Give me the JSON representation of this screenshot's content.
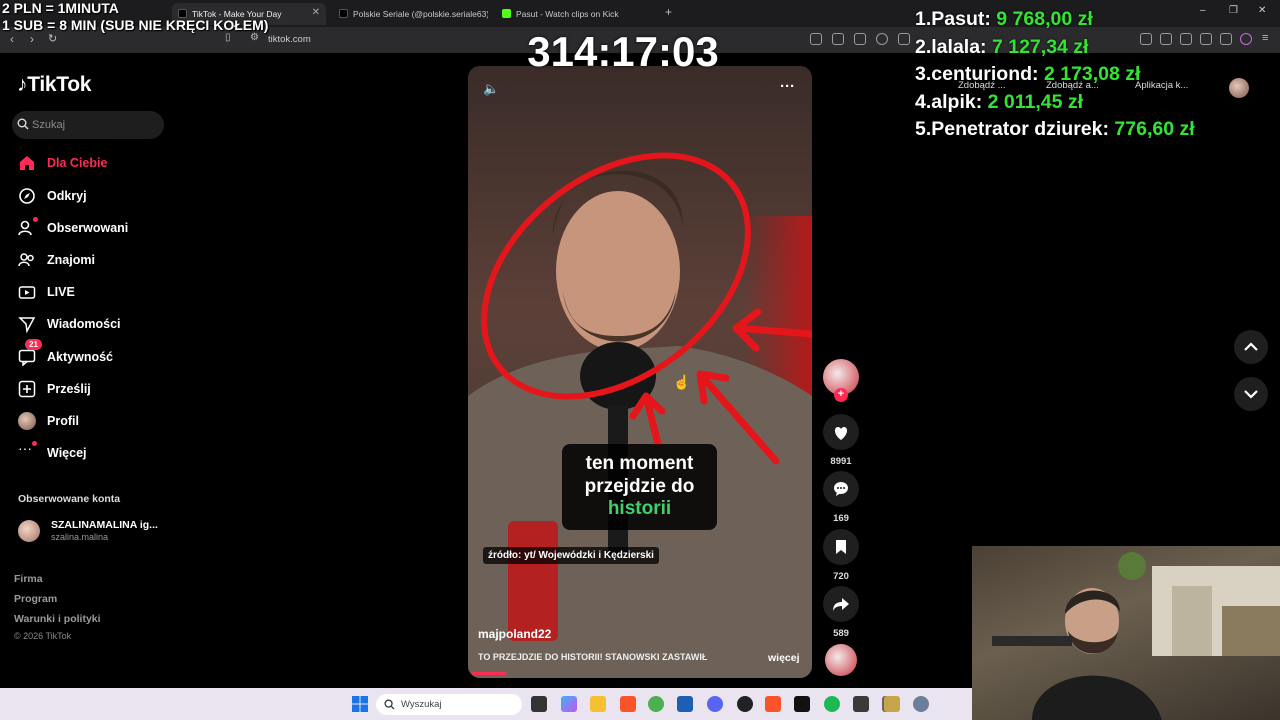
{
  "overlay": {
    "line1": "2 PLN = 1MINUTA",
    "line2": "1 SUB = 8 MIN (SUB NIE KRĘCI KOŁEM)",
    "timer": "314:17:03"
  },
  "leaderboard": [
    {
      "rank": "1.",
      "name": "Pasut:",
      "amount": "9 768,00 zł"
    },
    {
      "rank": "2.",
      "name": "lalala:",
      "amount": "7 127,34 zł"
    },
    {
      "rank": "3.",
      "name": "centuriond:",
      "amount": "2 173,08 zł"
    },
    {
      "rank": "4.",
      "name": "alpik:",
      "amount": "2 011,45 zł"
    },
    {
      "rank": "5.",
      "name": "Penetrator dziurek:",
      "amount": "776,60 zł"
    }
  ],
  "browser": {
    "tabs": [
      {
        "label": "TikTok - Make Your Day",
        "icon": "tiktok-icon",
        "color": "#111111"
      },
      {
        "label": "Polskie Seriale (@polskie.seriale63) |",
        "icon": "tiktok-icon",
        "color": "#111111"
      },
      {
        "label": "Pasut - Watch clips on Kick",
        "icon": "kick-icon",
        "color": "#53fc18"
      }
    ],
    "url": "tiktok.com",
    "pills": [
      "Zdobądź ...",
      "Zdobądź a...",
      "Aplikacja k..."
    ]
  },
  "tiktok": {
    "logo": "TikTok",
    "search_placeholder": "Szukaj",
    "nav": [
      {
        "label": "Dla Ciebie",
        "icon": "home-icon",
        "active": true
      },
      {
        "label": "Odkryj",
        "icon": "compass-icon"
      },
      {
        "label": "Obserwowani",
        "icon": "following-icon"
      },
      {
        "label": "Znajomi",
        "icon": "friends-icon"
      },
      {
        "label": "LIVE",
        "icon": "live-icon"
      },
      {
        "label": "Wiadomości",
        "icon": "messages-icon"
      },
      {
        "label": "Aktywność",
        "icon": "activity-icon",
        "badge": "21"
      },
      {
        "label": "Prześlij",
        "icon": "upload-icon"
      },
      {
        "label": "Profil",
        "icon": "profile-icon"
      },
      {
        "label": "Więcej",
        "icon": "more-icon"
      }
    ],
    "followed_header": "Obserwowane konta",
    "followed_account": {
      "name": "SZALINAMALINA ig...",
      "handle": "szalina.malina"
    },
    "footer": [
      "Firma",
      "Program",
      "Warunki i polityki"
    ],
    "copyright": "© 2026 TikTok"
  },
  "video": {
    "subtitle_line1": "ten moment",
    "subtitle_line2": "przejdzie do",
    "subtitle_line3": "historii",
    "source": "źródło: yt/ Wojewódzki i Kędzierski",
    "author": "majpoland22",
    "caption": "TO PRZEJDZIE DO HISTORII! STANOWSKI ZASTAWIŁ",
    "more": "więcej",
    "progress": 0.1,
    "likes": "8991",
    "comments": "169",
    "saves": "720",
    "shares": "589"
  },
  "taskbar": {
    "search_placeholder": "Wyszukaj"
  }
}
